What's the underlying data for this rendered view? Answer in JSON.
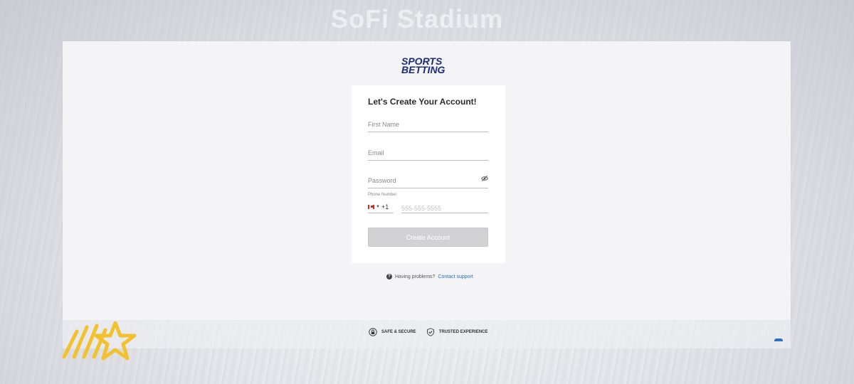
{
  "background": {
    "venue_text": "SoFi Stadium"
  },
  "logo": {
    "line1": "SPORTS",
    "line2": "BETTING",
    "color": "#1c2a7a"
  },
  "form": {
    "title": "Let's Create Your Account!",
    "first_name_placeholder": "First Name",
    "email_placeholder": "Email",
    "password_placeholder": "Password",
    "password_toggle_icon": "eye-slash-icon",
    "phone_label": "Phone Number",
    "country_flag": "canada-flag-icon",
    "country_code": "+1",
    "phone_placeholder": "555-555-5555",
    "submit_label": "Create Account"
  },
  "help": {
    "icon": "question-circle-icon",
    "text": "Having problems?",
    "link": "Contact support"
  },
  "badges": [
    {
      "icon": "lock-icon",
      "label": "SAFE & SECURE"
    },
    {
      "icon": "shield-check-icon",
      "label": "TRUSTED EXPERIENCE"
    }
  ],
  "colors": {
    "accent_link": "#2a6fb5",
    "button_disabled": "#d2d2d4",
    "star_logo": "#f2c12e"
  }
}
